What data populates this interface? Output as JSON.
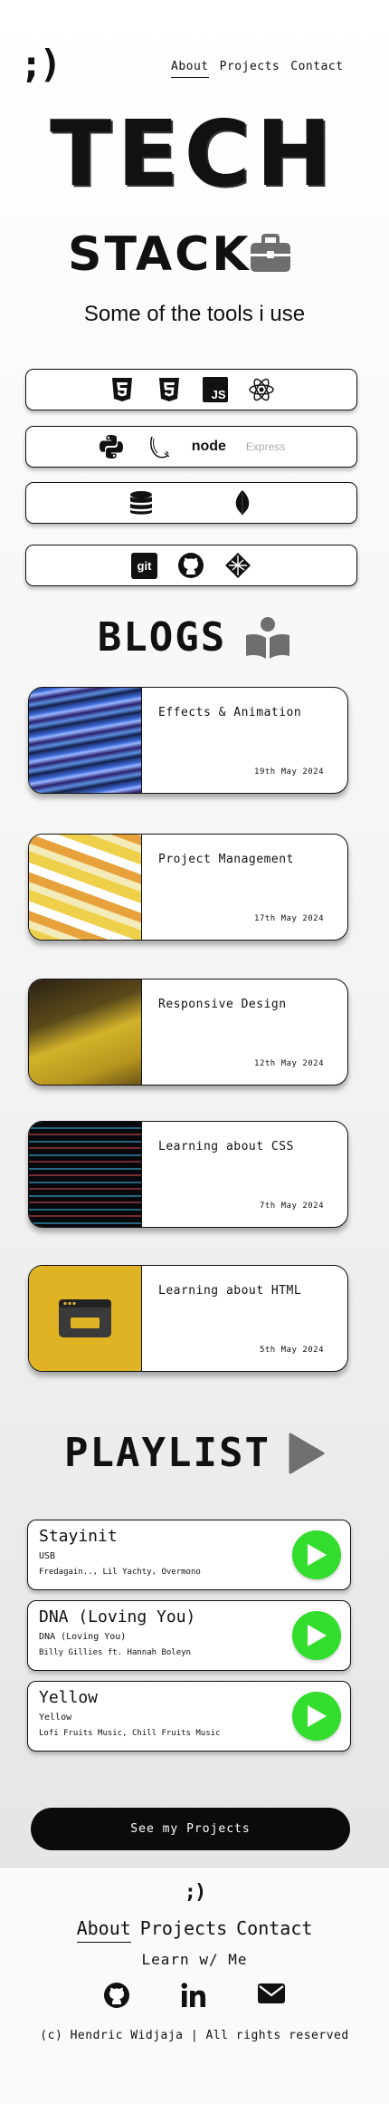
{
  "header": {
    "logo": ";)",
    "nav": [
      "About",
      "Projects",
      "Contact"
    ],
    "active_nav": "About"
  },
  "hero": {
    "title": "TECH",
    "subtitle": "STACK",
    "tagline": "Some of the tools i use"
  },
  "tools": {
    "express_label": "Express",
    "node_label": "node",
    "git_label": "git",
    "js_label": "JS"
  },
  "blogs": {
    "heading": "BLOGS",
    "items": [
      {
        "title": "Effects & Animation",
        "date": "19th May 2024"
      },
      {
        "title": "Project Management",
        "date": "17th May 2024"
      },
      {
        "title": "Responsive Design",
        "date": "12th May 2024"
      },
      {
        "title": "Learning about CSS",
        "date": "7th May 2024"
      },
      {
        "title": "Learning about HTML",
        "date": "5th May 2024"
      }
    ]
  },
  "playlist": {
    "heading": "PLAYLIST",
    "tracks": [
      {
        "title": "Stayinit",
        "album": "USB",
        "artists": "Fredagain.., Lil Yachty, Overmono"
      },
      {
        "title": "DNA (Loving You)",
        "album": "DNA (Loving You)",
        "artists": "Billy Gillies ft. Hannah Boleyn"
      },
      {
        "title": "Yellow",
        "album": "Yellow",
        "artists": "Lofi Fruits Music, Chill Fruits Music"
      }
    ]
  },
  "cta": {
    "label": "See my Projects"
  },
  "footer": {
    "logo": ";)",
    "nav": [
      "About",
      "Projects",
      "Contact"
    ],
    "learn": "Learn w/ Me",
    "copyright": "(c) Hendric Widjaja | All rights reserved"
  },
  "colors": {
    "play_green": "#33dd2e",
    "ink": "#111111"
  }
}
